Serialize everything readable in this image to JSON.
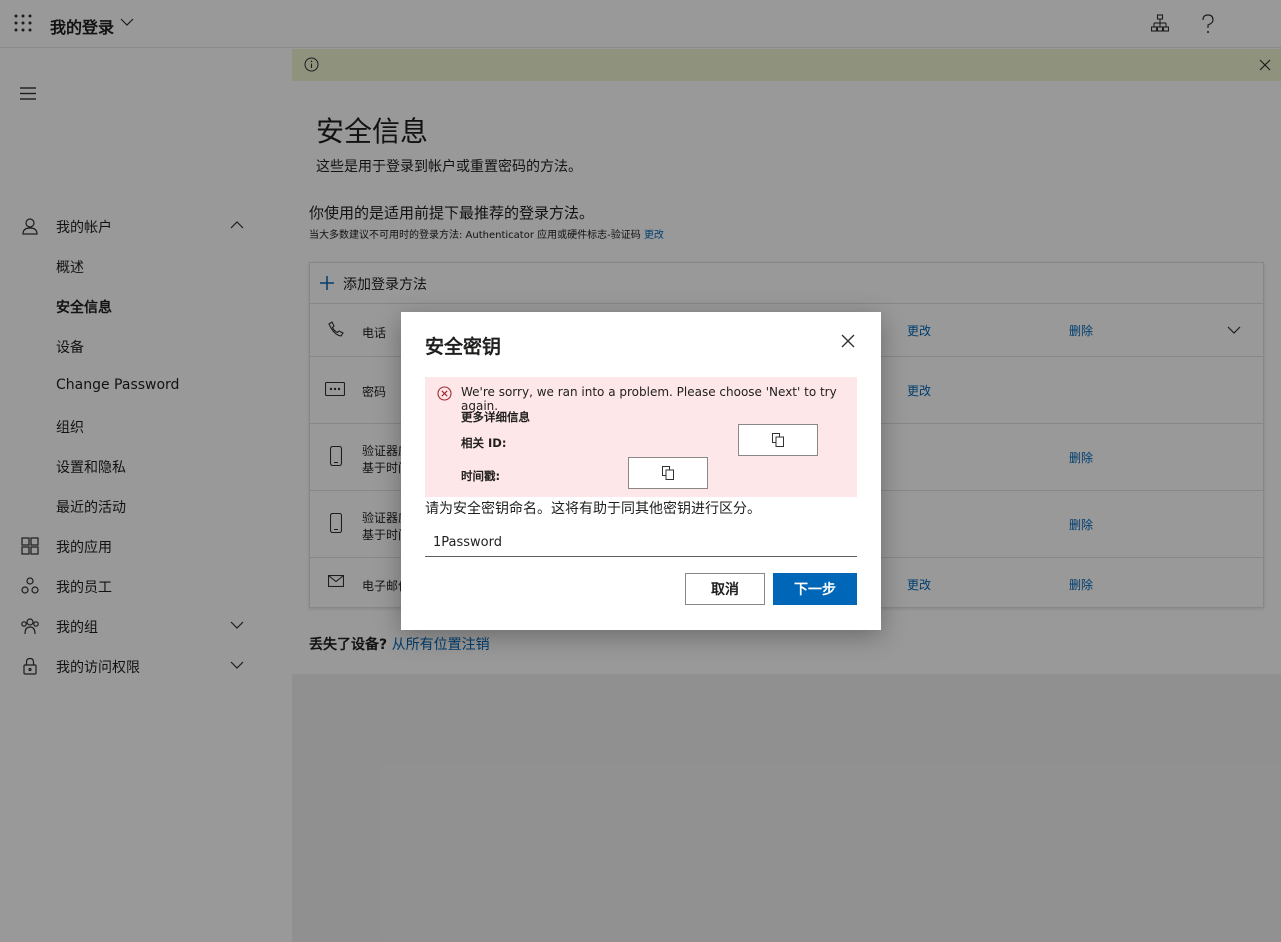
{
  "app": {
    "title": "我的登录"
  },
  "sidebar": {
    "items": [
      {
        "label": "我的帐户",
        "icon": "person-icon",
        "expanded": true
      },
      {
        "label": "概述"
      },
      {
        "label": "安全信息",
        "selected": true
      },
      {
        "label": "设备"
      },
      {
        "label": "Change Password"
      },
      {
        "label": "组织"
      },
      {
        "label": "设置和隐私"
      },
      {
        "label": "最近的活动"
      },
      {
        "label": "我的应用",
        "icon": "apps-icon"
      },
      {
        "label": "我的员工",
        "icon": "people-hierarchy-icon"
      },
      {
        "label": "我的组",
        "icon": "group-icon"
      },
      {
        "label": "我的访问权限",
        "icon": "lock-icon"
      }
    ]
  },
  "page": {
    "title": "安全信息",
    "subtitle": "这些是用于登录到帐户或重置密码的方法。",
    "recommendation": "你使用的是适用前提下最推荐的登录方法。",
    "default_method": "当大多数建议不可用时的登录方法: Authenticator 应用或硬件标志-验证码",
    "default_method_link": "更改",
    "add_method": "添加登录方法",
    "methods": [
      {
        "label": "电话",
        "change": "更改",
        "delete": "删除"
      },
      {
        "label": "密码",
        "change": "更改"
      },
      {
        "label": "验证器应",
        "sub": "基于时间",
        "delete": "删除"
      },
      {
        "label": "验证器应",
        "sub": "基于时间",
        "delete": "删除"
      },
      {
        "label": "电子邮件",
        "change": "更改",
        "delete": "删除"
      }
    ],
    "lost_device": "丢失了设备?",
    "lost_device_link": "从所有位置注销"
  },
  "dialog": {
    "title": "安全密钥",
    "error": {
      "message": "We're sorry, we ran into a problem. Please choose 'Next' to try again.",
      "more_details": "更多详细信息",
      "correlation_label": "相关 ID:",
      "timestamp_label": "时间戳:"
    },
    "description": "请为安全密钥命名。这将有助于同其他密钥进行区分。",
    "name_value": "1Password",
    "cancel": "取消",
    "next": "下一步"
  },
  "colors": {
    "accent": "#0067b8",
    "error_bg": "#fde7e9",
    "error_icon": "#a4262c",
    "notice_bg": "#eef6d2"
  }
}
